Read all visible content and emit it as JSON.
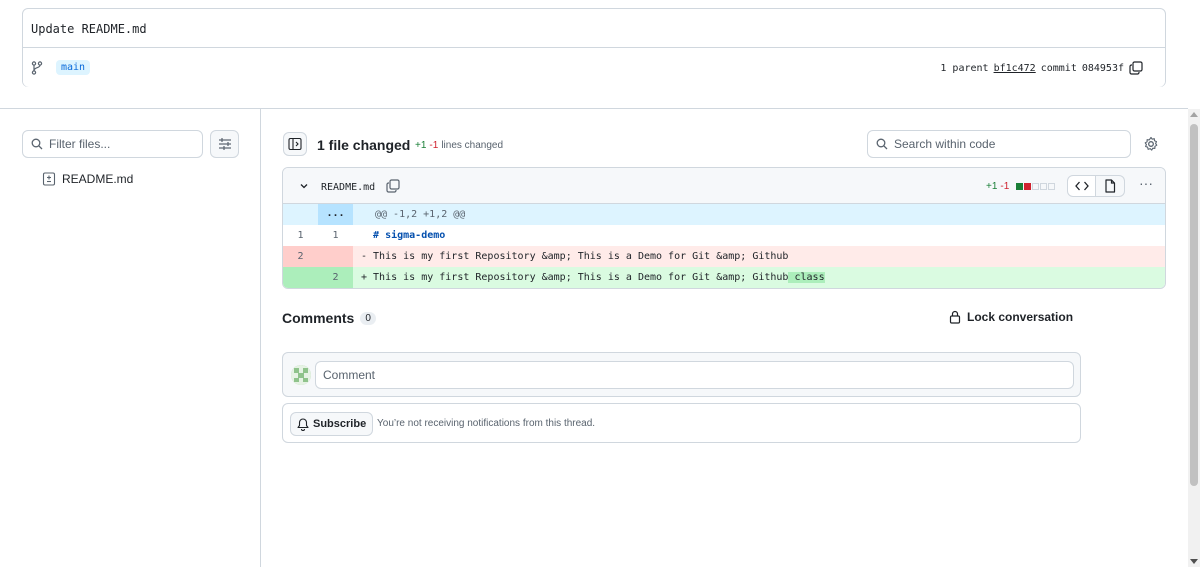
{
  "commit": {
    "title": "Update README.md",
    "branch": "main",
    "parent_label": "1 parent",
    "parent_sha": "bf1c472",
    "commit_label": "commit",
    "commit_sha": "084953f"
  },
  "sidebar": {
    "filter_placeholder": "Filter files...",
    "files": [
      {
        "name": "README.md"
      }
    ]
  },
  "toolbar": {
    "files_changed": "1 file changed",
    "additions": "+1",
    "deletions": "-1",
    "lines_changed_label": "lines changed",
    "search_placeholder": "Search within code"
  },
  "diff": {
    "filename": "README.md",
    "additions": "+1",
    "deletions": "-1",
    "expand_label": "...",
    "hunk_header": "@@ -1,2 +1,2 @@",
    "rows": [
      {
        "old": "1",
        "new": "1",
        "code": "  # sigma-demo"
      },
      {
        "old": "2",
        "new": "",
        "code": "- This is my first Repository &amp; This is a Demo for Git &amp; Github"
      },
      {
        "old": "",
        "new": "2",
        "code_prefix": "+ This is my first Repository &amp; This is a Demo for Git &amp; Github",
        "code_highlight": " class"
      }
    ],
    "more_label": "···"
  },
  "comments": {
    "title": "Comments",
    "count": "0",
    "lock_label": "Lock conversation",
    "input_placeholder": "Comment",
    "subscribe_label": "Subscribe",
    "subscribe_text": "You’re not receiving notifications from this thread."
  },
  "colors": {
    "accent": "#0969da",
    "add": "#1a7f37",
    "delete": "#cf222e",
    "add_bg": "#dafbe1",
    "delete_bg": "#ffebe9",
    "hunk_bg": "#ddf4ff"
  },
  "icons": {
    "branch": "git-branch-icon",
    "copy": "copy-icon",
    "search": "search-icon",
    "filter_settings": "sliders-icon",
    "file": "file-diff-icon",
    "tree_toggle": "sidebar-expand-icon",
    "gear": "gear-icon",
    "chevron": "chevron-down-icon",
    "code": "code-icon",
    "rich": "file-icon",
    "lock": "lock-icon",
    "bell": "bell-icon"
  }
}
